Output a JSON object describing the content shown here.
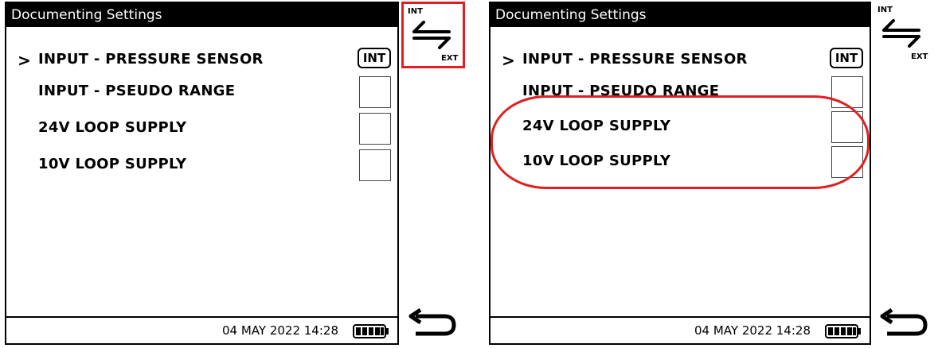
{
  "panels": [
    {
      "title": "Documenting Settings",
      "items": [
        {
          "label": "INPUT - PRESSURE SENSOR",
          "selected": true,
          "state": "INT"
        },
        {
          "label": "INPUT - PSEUDO RANGE",
          "selected": false,
          "state": ""
        },
        {
          "label": "24V LOOP SUPPLY",
          "selected": false,
          "state": ""
        },
        {
          "label": "10V LOOP SUPPLY",
          "selected": false,
          "state": ""
        }
      ],
      "datetime": "04 MAY 2022 14:28",
      "chevron": ">",
      "int_ext_icon": {
        "top_label": "INT",
        "bottom_label": "EXT"
      }
    },
    {
      "title": "Documenting Settings",
      "items": [
        {
          "label": "INPUT - PRESSURE SENSOR",
          "selected": true,
          "state": "INT"
        },
        {
          "label": "INPUT - PSEUDO RANGE",
          "selected": false,
          "state": ""
        },
        {
          "label": "24V LOOP SUPPLY",
          "selected": false,
          "state": ""
        },
        {
          "label": "10V LOOP SUPPLY",
          "selected": false,
          "state": ""
        }
      ],
      "datetime": "04 MAY 2022 14:28",
      "chevron": ">",
      "int_ext_icon": {
        "top_label": "INT",
        "bottom_label": "EXT"
      }
    }
  ],
  "icons": {
    "int_ext_toggle": "int-ext-swap-icon",
    "back": "back-arrow-icon",
    "battery": "battery-icon"
  },
  "colors": {
    "highlight": "#e02020",
    "title_bg": "#000000"
  }
}
